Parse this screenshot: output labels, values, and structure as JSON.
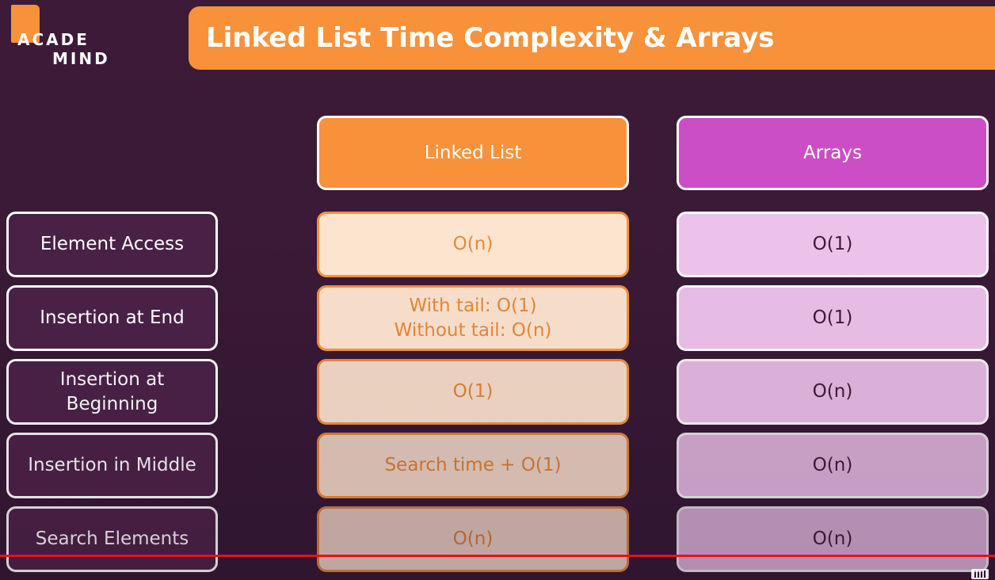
{
  "logo": {
    "line1": "ACADE",
    "line2": "MIND"
  },
  "title": "Linked List Time Complexity & Arrays",
  "columns": {
    "linked_list": "Linked List",
    "arrays": "Arrays"
  },
  "rows": [
    {
      "label": "Element Access",
      "linked_list": "O(n)",
      "arrays": "O(1)"
    },
    {
      "label": "Insertion at End",
      "linked_list": "With tail: O(1)\nWithout tail: O(n)",
      "arrays": "O(1)"
    },
    {
      "label": "Insertion at\nBeginning",
      "linked_list": "O(1)",
      "arrays": "O(n)"
    },
    {
      "label": "Insertion in Middle",
      "linked_list": "Search time + O(1)",
      "arrays": "O(n)"
    },
    {
      "label": "Search Elements",
      "linked_list": "O(n)",
      "arrays": "O(n)"
    }
  ],
  "colors": {
    "accent_orange": "#f7923a",
    "accent_magenta": "#cc4ec7",
    "background": "#3c1a38",
    "progress_bar": "#e0151b"
  },
  "icons": {
    "keyboard": "keyboard-icon"
  }
}
